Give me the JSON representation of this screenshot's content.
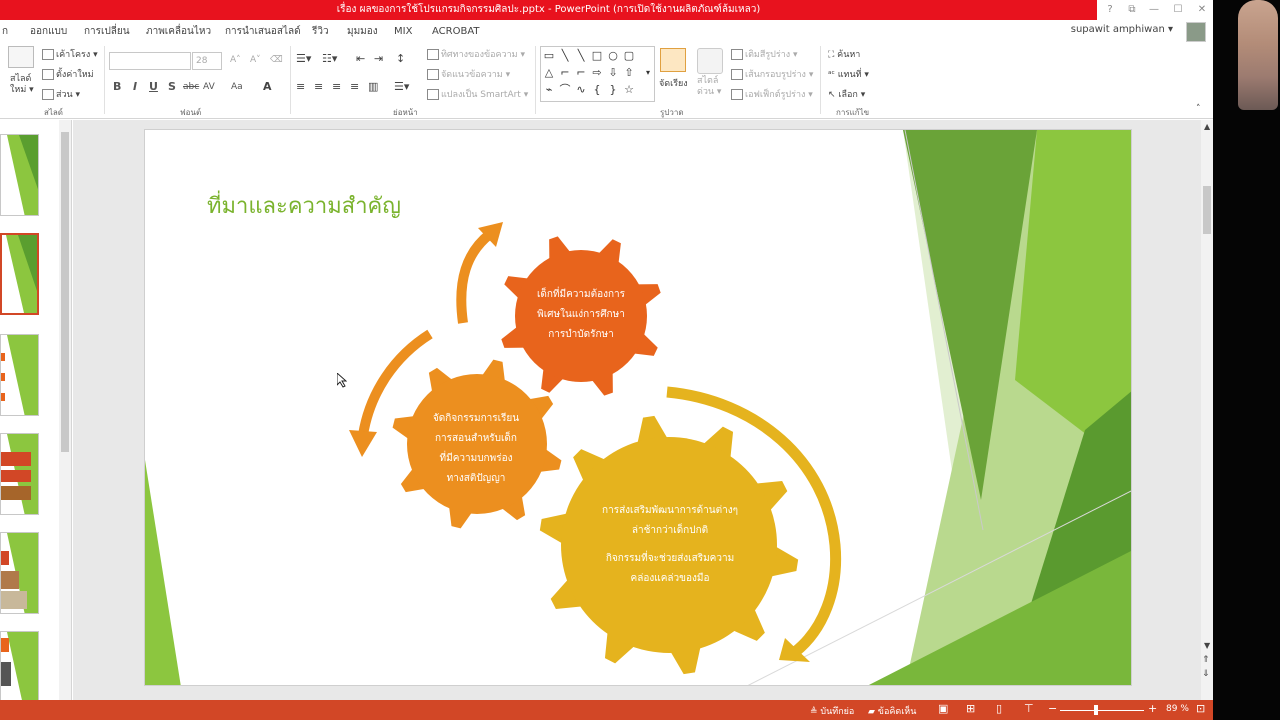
{
  "window": {
    "title": "เรื่อง ผลของการใช้โปรแกรมกิจกรรมศิลปะ.pptx - PowerPoint (การเปิดใช้งานผลิตภัณฑ์ล้มเหลว)",
    "help": "?",
    "restore": "⧉",
    "minimize": "—",
    "maximize": "☐",
    "close": "✕"
  },
  "menu": {
    "file_tab": "ก",
    "tabs": [
      "ออกแบบ",
      "การเปลี่ยน",
      "ภาพเคลื่อนไหว",
      "การนำเสนอสไลด์",
      "รีวิว",
      "มุมมอง",
      "MIX",
      "ACROBAT"
    ],
    "user": "supawit amphiwan ▾"
  },
  "ribbon": {
    "slides": {
      "new_slide": "สไลด์\nใหม่ ▾",
      "layout": "เค้าโครง ▾",
      "reset": "ตั้งค่าใหม่",
      "section": "ส่วน ▾",
      "label": "สไลด์"
    },
    "font": {
      "font_name": "",
      "font_size": "28",
      "label": "ฟอนต์",
      "bold": "B",
      "italic": "I",
      "underline": "U",
      "shadow": "S",
      "strike": "abc",
      "spacing": "AV",
      "case": "Aa",
      "color": "A"
    },
    "paragraph": {
      "text_direction": "ทิศทางของข้อความ ▾",
      "align_text": "จัดแนวข้อความ ▾",
      "smartart": "แปลงเป็น SmartArt ▾",
      "label": "ย่อหน้า"
    },
    "drawing": {
      "arrange": "จัดเรียง",
      "quick_styles": "สไตล์\nด่วน ▾",
      "fill": "เติมสีรูปร่าง ▾",
      "outline": "เส้นกรอบรูปร่าง ▾",
      "effects": "เอฟเฟ็กต์รูปร่าง ▾",
      "label": "รูปวาด"
    },
    "editing": {
      "find": "ค้นหา",
      "replace": "แทนที่ ▾",
      "select": "เลือก ▾",
      "label": "การแก้ไข"
    }
  },
  "slide": {
    "title": "ที่มาและความสำคัญ",
    "gears": [
      {
        "lines": [
          "เด็กที่มีความต้องการ",
          "พิเศษในแง่การศึกษา",
          "การบำบัดรักษา"
        ],
        "color": "#e8641c"
      },
      {
        "lines": [
          "จัดกิจกรรมการเรียน",
          "การสอนสำหรับเด็ก",
          "ที่มีความบกพร่อง",
          "ทางสติปัญญา"
        ],
        "color": "#ec8f1f"
      },
      {
        "lines": [
          "การส่งเสริมพัฒนาการด้านต่างๆ",
          "ล่าช้ากว่าเด็กปกติ",
          "",
          "กิจกรรมที่จะช่วยส่งเสริมความ",
          "คล่องแคล่วของมือ"
        ],
        "color": "#e5b31e"
      }
    ],
    "accent_green": "#7ab32d"
  },
  "statusbar": {
    "notes": "บันทึกย่อ",
    "comments": "ข้อคิดเห็น",
    "zoom": "89 %",
    "zoom_minus": "−",
    "zoom_plus": "+"
  }
}
